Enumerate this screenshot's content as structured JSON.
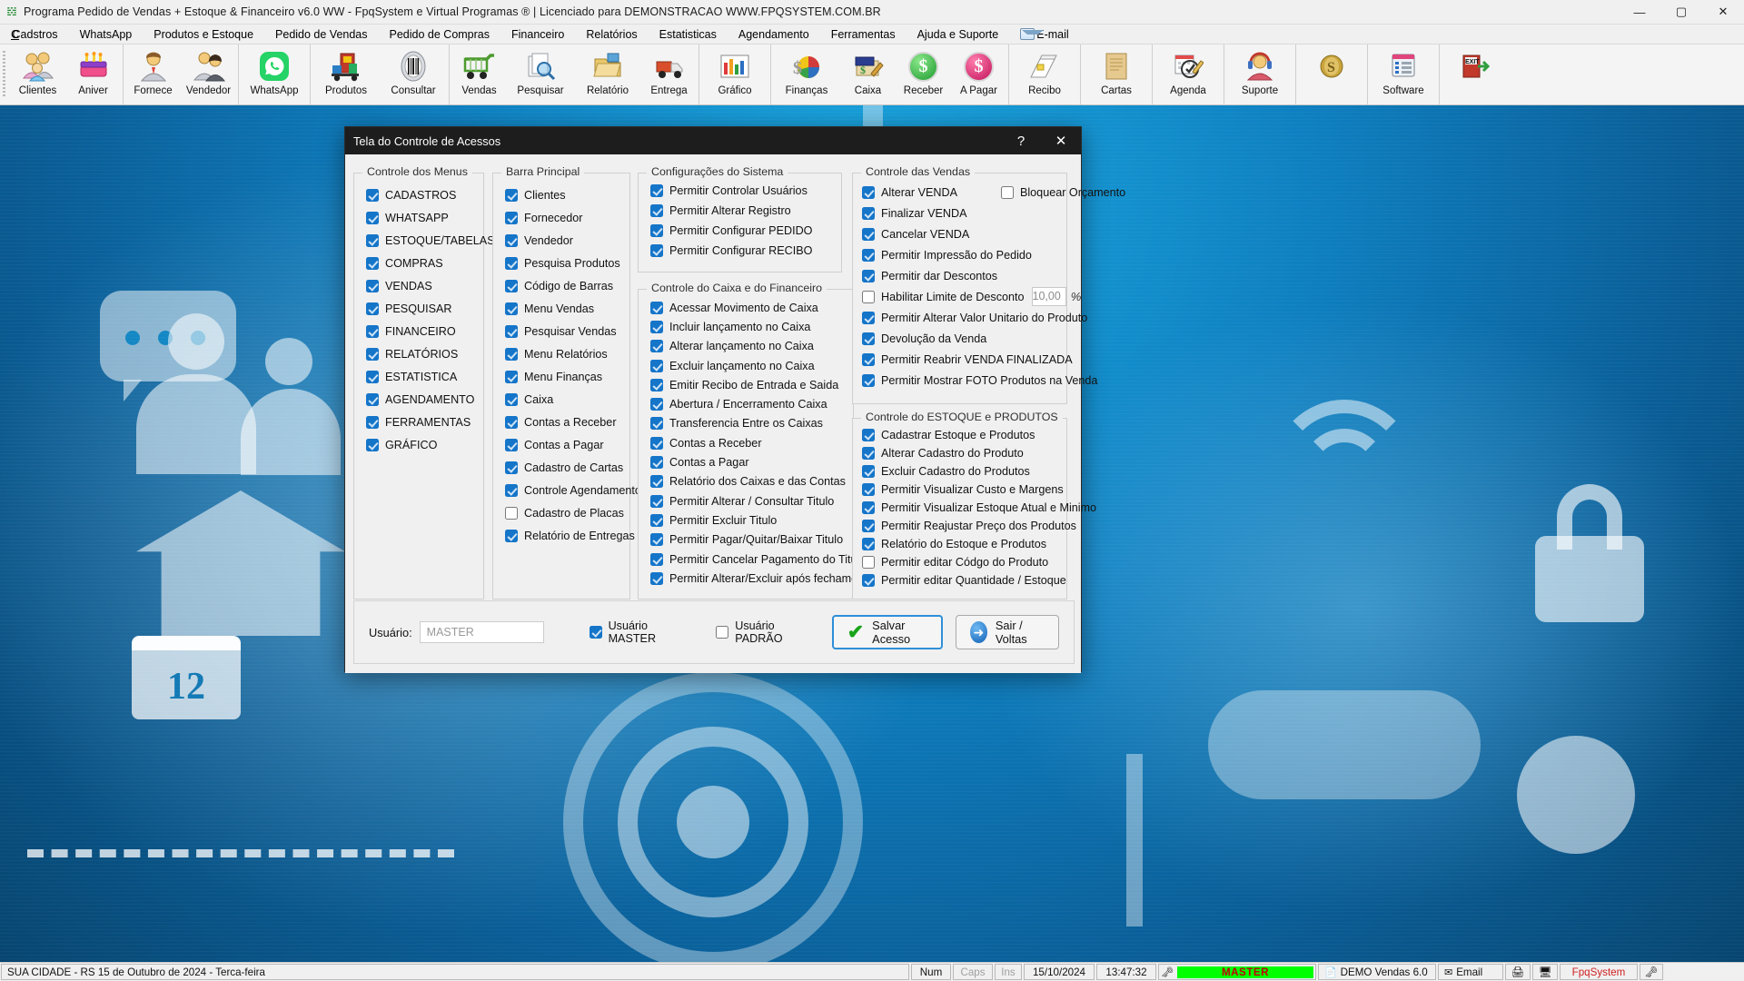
{
  "titlebar": {
    "icon": "app-icon",
    "title": "Programa Pedido de Vendas + Estoque & Financeiro v6.0 WW - FpqSystem e Virtual Programas ® | Licenciado para  DEMONSTRACAO WWW.FPQSYSTEM.COM.BR",
    "minimize": "—",
    "maximize": "▢",
    "close": "✕"
  },
  "menubar": [
    {
      "label": "Cadstros",
      "accel": "C"
    },
    {
      "label": "WhatsApp",
      "accel": "W"
    },
    {
      "label": "Produtos e Estoque",
      "accel": "P"
    },
    {
      "label": "Pedido de Vendas",
      "accel": "P"
    },
    {
      "label": "Pedido de Compras",
      "accel": "P"
    },
    {
      "label": "Financeiro",
      "accel": ""
    },
    {
      "label": "Relatórios",
      "accel": ""
    },
    {
      "label": "Estatisticas",
      "accel": ""
    },
    {
      "label": "Agendamento",
      "accel": "A"
    },
    {
      "label": "Ferramentas",
      "accel": ""
    },
    {
      "label": "Ajuda e Suporte",
      "accel": "A"
    },
    {
      "label": "E-mail",
      "accel": ""
    }
  ],
  "toolbar": {
    "groups": [
      {
        "buttons": [
          {
            "label": "Clientes",
            "icon": "clients-icon",
            "glyph": "👥"
          },
          {
            "label": "Aniver",
            "icon": "birthday-cake-icon",
            "glyph": "🎂"
          }
        ]
      },
      {
        "buttons": [
          {
            "label": "Fornece",
            "icon": "supplier-icon",
            "glyph": "👤"
          },
          {
            "label": "Vendedor",
            "icon": "salesperson-icon",
            "glyph": "👥"
          }
        ]
      },
      {
        "buttons": [
          {
            "label": "WhatsApp",
            "icon": "whatsapp-icon",
            "glyph": "✆"
          }
        ]
      },
      {
        "buttons": [
          {
            "label": "Produtos",
            "icon": "products-cart-icon",
            "glyph": "🛒"
          },
          {
            "label": "Consultar",
            "icon": "barcode-icon",
            "glyph": "▌▌▌"
          }
        ]
      },
      {
        "buttons": [
          {
            "label": "Vendas",
            "icon": "sales-cart-icon",
            "glyph": "🛒"
          },
          {
            "label": "Pesquisar",
            "icon": "search-docs-icon",
            "glyph": "🔍"
          },
          {
            "label": "Relatório",
            "icon": "report-icon",
            "glyph": "🗂"
          },
          {
            "label": "Entrega",
            "icon": "delivery-icon",
            "glyph": "🚚"
          }
        ]
      },
      {
        "buttons": [
          {
            "label": "Gráfico",
            "icon": "bar-chart-icon",
            "glyph": "📊"
          }
        ]
      },
      {
        "buttons": [
          {
            "label": "Finanças",
            "icon": "finance-pie-icon",
            "glyph": "◕"
          },
          {
            "label": "Caixa",
            "icon": "cash-book-icon",
            "glyph": "📒"
          },
          {
            "label": "Receber",
            "icon": "receive-money-icon",
            "glyph": "$"
          },
          {
            "label": "A Pagar",
            "icon": "pay-money-icon",
            "glyph": "$"
          }
        ]
      },
      {
        "buttons": [
          {
            "label": "Recibo",
            "icon": "receipt-icon",
            "glyph": "🧾"
          }
        ]
      },
      {
        "buttons": [
          {
            "label": "Cartas",
            "icon": "letters-icon",
            "glyph": "📜"
          }
        ]
      },
      {
        "buttons": [
          {
            "label": "Agenda",
            "icon": "calendar-pen-icon",
            "glyph": "🗓"
          }
        ]
      },
      {
        "buttons": [
          {
            "label": "Suporte",
            "icon": "support-headset-icon",
            "glyph": "🎧"
          }
        ]
      },
      {
        "buttons": [
          {
            "label": "",
            "icon": "coin-icon",
            "glyph": "◉"
          }
        ]
      },
      {
        "buttons": [
          {
            "label": "Software",
            "icon": "software-icon",
            "glyph": "🖥"
          }
        ]
      },
      {
        "buttons": [
          {
            "label": "",
            "icon": "exit-door-icon",
            "glyph": "⎋"
          }
        ]
      }
    ]
  },
  "dialog": {
    "title": "Tela do Controle de Acessos",
    "help_btn": "?",
    "close_btn": "✕",
    "groups": {
      "menus": {
        "legend": "Controle dos Menus",
        "items": [
          {
            "label": "CADASTROS",
            "checked": true
          },
          {
            "label": "WHATSAPP",
            "checked": true
          },
          {
            "label": "ESTOQUE/TABELAS",
            "checked": true
          },
          {
            "label": "COMPRAS",
            "checked": true
          },
          {
            "label": "VENDAS",
            "checked": true
          },
          {
            "label": "PESQUISAR",
            "checked": true
          },
          {
            "label": "FINANCEIRO",
            "checked": true
          },
          {
            "label": "RELATÓRIOS",
            "checked": true
          },
          {
            "label": "ESTATISTICA",
            "checked": true
          },
          {
            "label": "AGENDAMENTO",
            "checked": true
          },
          {
            "label": "FERRAMENTAS",
            "checked": true
          },
          {
            "label": "GRÁFICO",
            "checked": true
          }
        ]
      },
      "mainbar": {
        "legend": "Barra Principal",
        "items": [
          {
            "label": "Clientes",
            "checked": true
          },
          {
            "label": "Fornecedor",
            "checked": true
          },
          {
            "label": "Vendedor",
            "checked": true
          },
          {
            "label": "Pesquisa Produtos",
            "checked": true
          },
          {
            "label": "Código de Barras",
            "checked": true
          },
          {
            "label": "Menu Vendas",
            "checked": true
          },
          {
            "label": "Pesquisar Vendas",
            "checked": true
          },
          {
            "label": "Menu Relatórios",
            "checked": true
          },
          {
            "label": "Menu Finanças",
            "checked": true
          },
          {
            "label": "Caixa",
            "checked": true
          },
          {
            "label": "Contas a Receber",
            "checked": true
          },
          {
            "label": "Contas a Pagar",
            "checked": true
          },
          {
            "label": "Cadastro de Cartas",
            "checked": true
          },
          {
            "label": "Controle Agendamento",
            "checked": true
          },
          {
            "label": "Cadastro de Placas",
            "checked": false
          },
          {
            "label": "Relatório de Entregas",
            "checked": true
          }
        ]
      },
      "system": {
        "legend": "Configurações do Sistema",
        "items": [
          {
            "label": "Permitir Controlar Usuários",
            "checked": true
          },
          {
            "label": "Permitir Alterar Registro",
            "checked": true
          },
          {
            "label": "Permitir Configurar PEDIDO",
            "checked": true
          },
          {
            "label": "Permitir Configurar RECIBO",
            "checked": true
          }
        ]
      },
      "cashier": {
        "legend": "Controle do Caixa e do Financeiro",
        "items": [
          {
            "label": "Acessar Movimento de Caixa",
            "checked": true
          },
          {
            "label": "Incluir lançamento no Caixa",
            "checked": true
          },
          {
            "label": "Alterar lançamento no Caixa",
            "checked": true
          },
          {
            "label": "Excluir lançamento no Caixa",
            "checked": true
          },
          {
            "label": "Emitir Recibo de Entrada e Saida",
            "checked": true
          },
          {
            "label": "Abertura / Encerramento Caixa",
            "checked": true
          },
          {
            "label": "Transferencia Entre os Caixas",
            "checked": true
          },
          {
            "label": "Contas a Receber",
            "checked": true
          },
          {
            "label": "Contas a Pagar",
            "checked": true
          },
          {
            "label": "Relatório dos Caixas e das Contas",
            "checked": true
          },
          {
            "label": "Permitir Alterar / Consultar Titulo",
            "checked": true
          },
          {
            "label": "Permitir Excluir Titulo",
            "checked": true
          },
          {
            "label": "Permitir Pagar/Quitar/Baixar Titulo",
            "checked": true
          },
          {
            "label": "Permitir Cancelar Pagamento do Titulo",
            "checked": true
          },
          {
            "label": "Permitir Alterar/Excluir após fechamento",
            "checked": true
          }
        ]
      },
      "sales": {
        "legend": "Controle das Vendas",
        "items": [
          {
            "label": "Alterar VENDA",
            "checked": true
          },
          {
            "label": "Finalizar VENDA",
            "checked": true
          },
          {
            "label": "Cancelar VENDA",
            "checked": true
          },
          {
            "label": "Permitir Impressão do Pedido",
            "checked": true
          },
          {
            "label": "Permitir dar Descontos",
            "checked": true
          },
          {
            "label": "Habilitar Limite de Desconto",
            "checked": false
          },
          {
            "label": "Permitir Alterar Valor Unitario do Produto",
            "checked": true
          },
          {
            "label": "Devolução da Venda",
            "checked": true
          },
          {
            "label": "Permitir Reabrir VENDA FINALIZADA",
            "checked": true
          },
          {
            "label": "Permitir Mostrar FOTO Produtos na Venda",
            "checked": true
          }
        ],
        "block_budget": {
          "label": "Bloquear Orçamento",
          "checked": false
        },
        "discount_limit_value": "10,00",
        "discount_unit": "%"
      },
      "stock": {
        "legend": "Controle do ESTOQUE e PRODUTOS",
        "items": [
          {
            "label": "Cadastrar Estoque e Produtos",
            "checked": true
          },
          {
            "label": "Alterar Cadastro do Produto",
            "checked": true
          },
          {
            "label": "Excluir Cadastro do Produtos",
            "checked": true
          },
          {
            "label": "Permitir Visualizar Custo e Margens",
            "checked": true
          },
          {
            "label": "Permitir Visualizar Estoque Atual e Minimo",
            "checked": true
          },
          {
            "label": "Permitir Reajustar Preço dos Produtos",
            "checked": true
          },
          {
            "label": "Relatório do Estoque e Produtos",
            "checked": true
          },
          {
            "label": "Permitir editar Códgo do Produto",
            "checked": false
          },
          {
            "label": "Permitir editar Quantidade / Estoque",
            "checked": true
          }
        ]
      }
    },
    "footer": {
      "user_label": "Usuário:",
      "user_value": "MASTER",
      "master_checkbox": {
        "label": "Usuário MASTER",
        "checked": true
      },
      "default_checkbox": {
        "label": "Usuário PADRÃO",
        "checked": false
      },
      "save_button": "Salvar Acesso",
      "exit_button": "Sair / Voltas"
    }
  },
  "statusbar": {
    "location_text": "SUA CIDADE - RS 15 de Outubro de 2024 - Terca-feira",
    "num": "Num",
    "caps": "Caps",
    "ins": "Ins",
    "date": "15/10/2024",
    "time": "13:47:32",
    "user": "MASTER",
    "demo": "DEMO Vendas 6.0",
    "email": "Email",
    "brand": "FpqSystem"
  },
  "colors": {
    "accent_blue": "#1575c9",
    "title_dark": "#1d1d1d",
    "status_green": "#00ff00",
    "brand_red": "#d02020"
  }
}
